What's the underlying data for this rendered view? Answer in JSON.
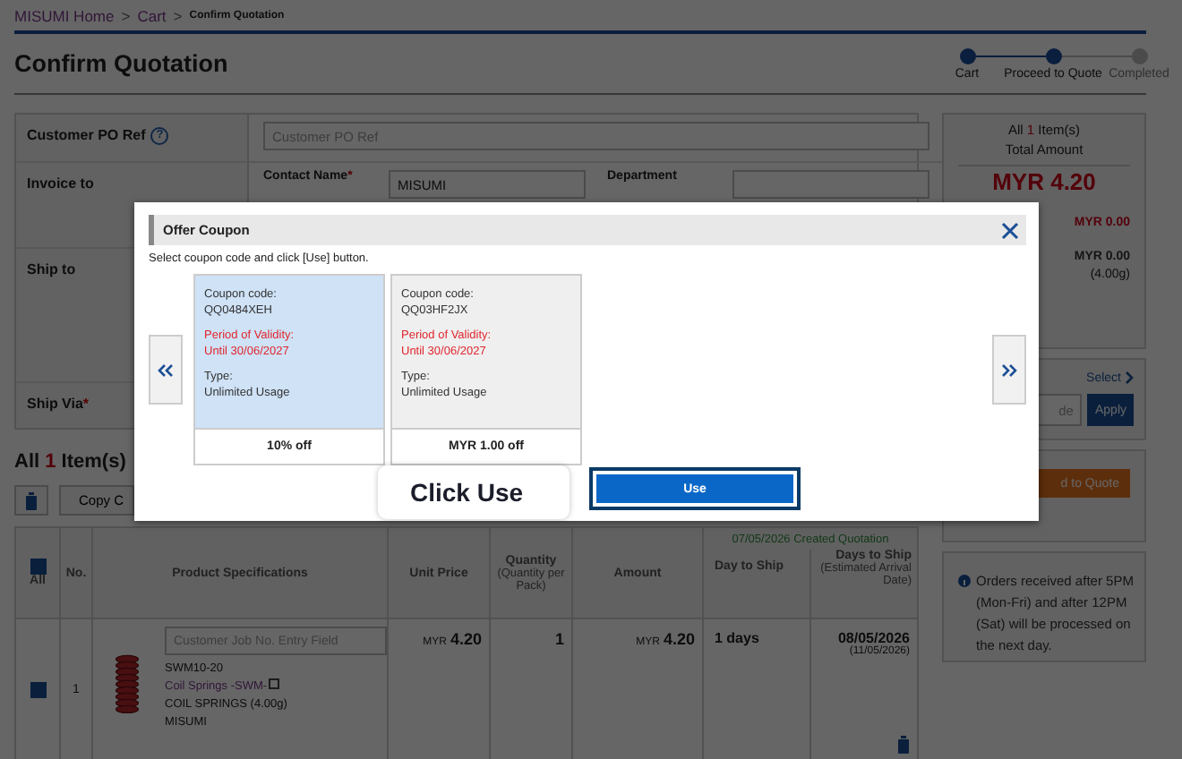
{
  "breadcrumb": [
    {
      "label": "MISUMI Home",
      "link": true
    },
    {
      "prefix": ">",
      "label": "Cart",
      "link": true
    },
    {
      "prefix": ">",
      "label": "Confirm Quotation",
      "link": false
    }
  ],
  "page_title": "Confirm Quotation",
  "steps": [
    {
      "label": "Cart",
      "reached": true
    },
    {
      "label": "Proceed to Quote",
      "reached": true
    },
    {
      "label": "Completed",
      "reached": false
    }
  ],
  "form": [
    {
      "kind": "input",
      "label": "Customer PO Ref",
      "help_mark": "?",
      "placeholder": "Customer PO Ref"
    },
    {
      "kind": "contact",
      "label": "Invoice to",
      "fields": [
        {
          "label": "Contact Name",
          "required_mark": "*",
          "value": "MISUMI"
        },
        {
          "label": "Department"
        }
      ]
    },
    {
      "kind": "blank",
      "label": "Ship to"
    },
    {
      "kind": "blank",
      "label": "Ship Via",
      "required_mark": "*"
    }
  ],
  "items_heading": {
    "prefix": "All",
    "count": "1",
    "suffix": "Item(s)"
  },
  "toolbar": {
    "copy_label": "Copy C"
  },
  "table": {
    "select_all": {
      "checked": true,
      "label": "All"
    },
    "note": "07/05/2026 Created Quotation",
    "columns": [
      {
        "label": "No."
      },
      {
        "label": "Product Specifications"
      },
      {
        "label": "Unit Price"
      },
      {
        "label": "Quantity",
        "sublabel": "(Quantity per Pack)"
      },
      {
        "label": "Amount"
      },
      {
        "label": "Day to Ship"
      },
      {
        "label": "Days to Ship",
        "sublabel": "(Estimated Arrival Date)"
      }
    ],
    "rows": [
      {
        "checked": true,
        "no": "1",
        "job_placeholder": "Customer Job No. Entry Field",
        "part": "SWM10-20",
        "name": "Coil Springs -SWM-",
        "desc": "COIL SPRINGS (4.00g)",
        "brand": "MISUMI",
        "unit_currency": "MYR",
        "unit_price": "4.20",
        "quantity": "1",
        "amount_currency": "MYR",
        "amount": "4.20",
        "days": "1 days",
        "ship_date": "08/05/2026",
        "arrival": "(11/05/2026)"
      }
    ]
  },
  "summary": {
    "count_prefix": "All",
    "count": "1",
    "count_suffix": "Item(s)",
    "total_label": "Total Amount",
    "total": "MYR 4.20",
    "discount": "MYR 0.00",
    "shipping": "MYR 0.00",
    "weight": "(4.00g)"
  },
  "coupon_box": {
    "select_link": "Select",
    "placeholder": "de",
    "apply": "Apply"
  },
  "quote_button": "d to Quote",
  "notice": "Orders received after 5PM (Mon-Fri) and after 12PM (Sat) will be processed on the next day.",
  "dialog": {
    "title": "Offer Coupon",
    "instruction": "Select coupon code and click [Use] button.",
    "coupons": [
      {
        "selected": true,
        "code_label": "Coupon code:",
        "code": "QQ0484XEH",
        "validity_label": "Period of Validity:",
        "validity": "Until 30/06/2027",
        "type_label": "Type:",
        "type": "Unlimited Usage",
        "offer": "10% off"
      },
      {
        "selected": false,
        "code_label": "Coupon code:",
        "code": "QQ03HF2JX",
        "validity_label": "Period of Validity:",
        "validity": "Until 30/06/2027",
        "type_label": "Type:",
        "type": "Unlimited Usage",
        "offer": "MYR 1.00 off"
      }
    ],
    "use_button": "Use"
  },
  "callout": "Click Use"
}
